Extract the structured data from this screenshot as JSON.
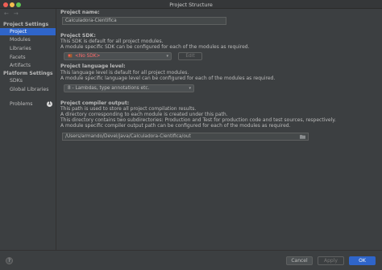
{
  "window": {
    "title": "Project Structure"
  },
  "sidebar": {
    "nav": {
      "back": "←",
      "forward": "→"
    },
    "project_settings_heading": "Project Settings",
    "project_items": [
      {
        "label": "Project",
        "active": true
      },
      {
        "label": "Modules"
      },
      {
        "label": "Libraries"
      },
      {
        "label": "Facets"
      },
      {
        "label": "Artifacts"
      }
    ],
    "platform_settings_heading": "Platform Settings",
    "platform_items": [
      {
        "label": "SDKs"
      },
      {
        "label": "Global Libraries"
      }
    ],
    "problems": {
      "label": "Problems",
      "count": "1"
    }
  },
  "project": {
    "name_label": "Project name:",
    "name_value": "Calculadora-Cientifica",
    "sdk_label": "Project SDK:",
    "sdk_desc_1": "This SDK is default for all project modules.",
    "sdk_desc_2": "A module specific SDK can be configured for each of the modules as required.",
    "sdk_value": "<No SDK>",
    "sdk_edit": "Edit",
    "language_label": "Project language level:",
    "language_desc_1": "This language level is default for all project modules.",
    "language_desc_2": "A module specific language level can be configured for each of the modules as required.",
    "language_value": "8 - Lambdas, type annotations etc.",
    "output_label": "Project compiler output:",
    "output_desc_1": "This path is used to store all project compilation results.",
    "output_desc_2": "A directory corresponding to each module is created under this path.",
    "output_desc_3": "This directory contains two subdirectories: Production and Test for production code and test sources, respectively.",
    "output_desc_4": "A module specific compiler output path can be configured for each of the modules as required.",
    "output_value": "/Users/armando/Devel/java/Calculadora-Cientifica/out"
  },
  "footer": {
    "help": "?",
    "cancel": "Cancel",
    "apply": "Apply",
    "ok": "OK"
  },
  "colors": {
    "accent": "#2f65ca",
    "sdk_error": "#ff6b6b"
  }
}
